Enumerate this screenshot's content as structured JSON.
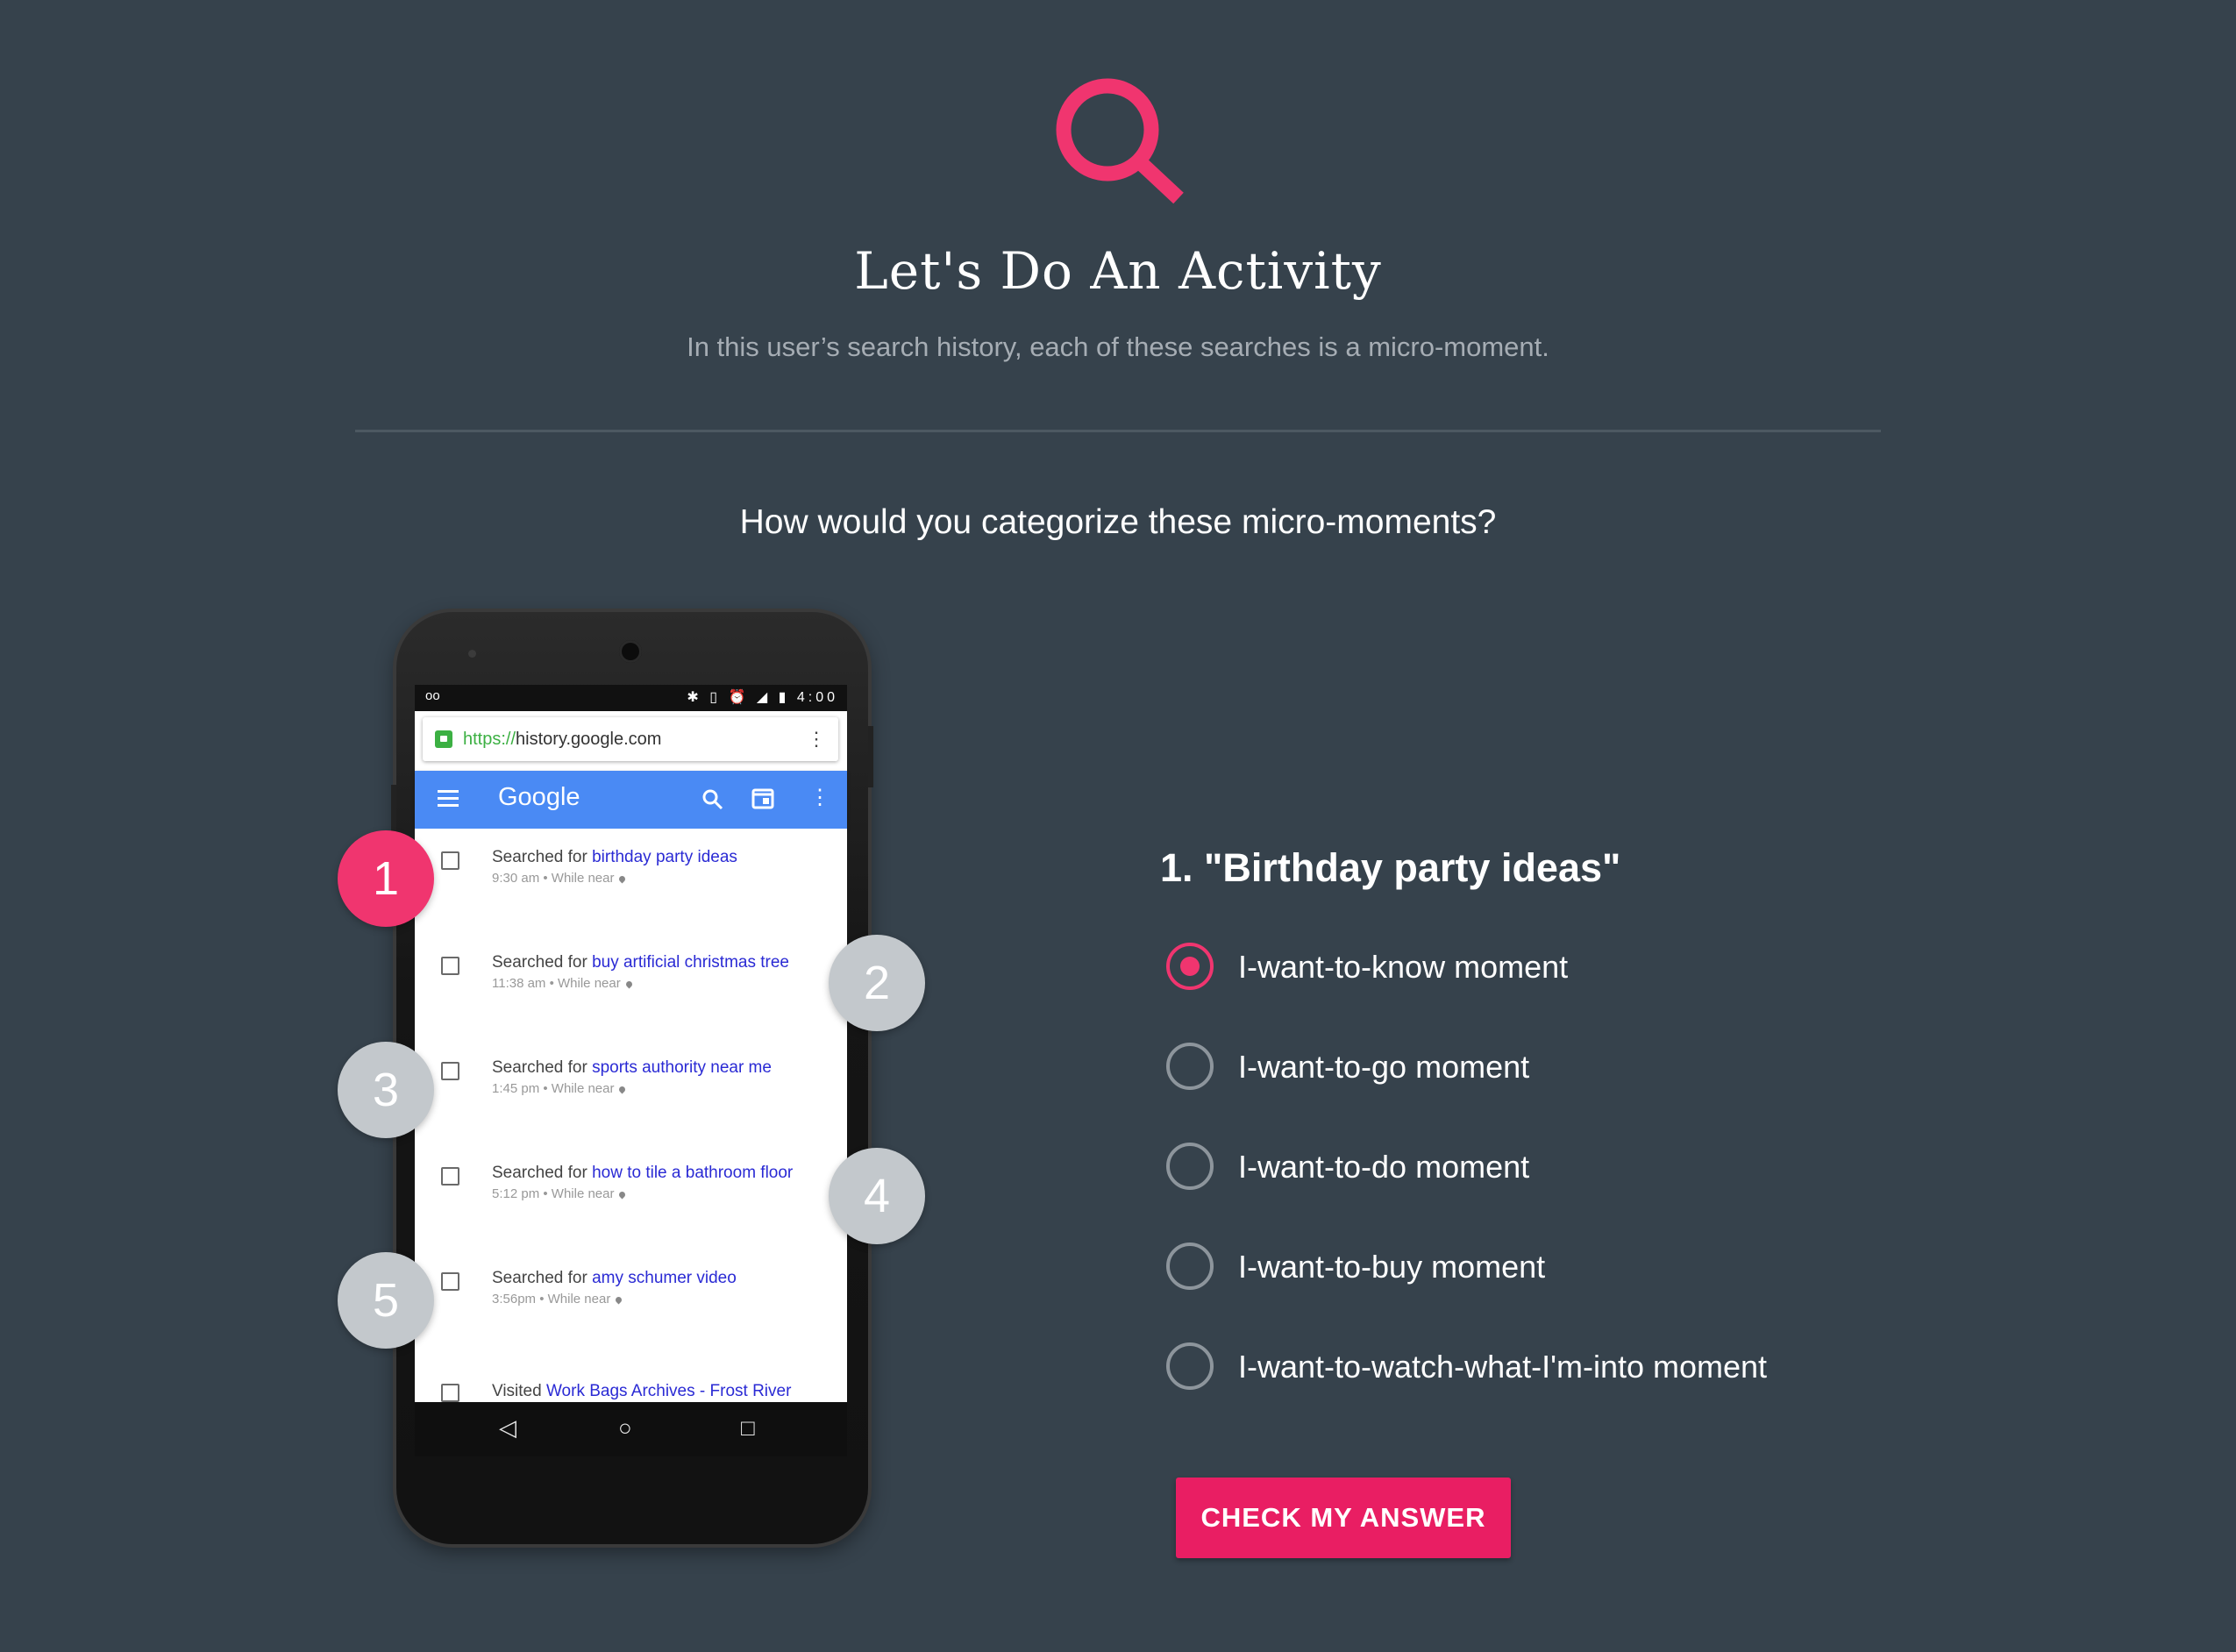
{
  "header": {
    "title": "Let's Do An Activity",
    "subtitle": "In this user’s search history, each of these searches is a micro-moment.",
    "prompt": "How would you categorize these micro-moments?",
    "icon": "search-icon",
    "accent_color": "#f0356f"
  },
  "phone": {
    "status": {
      "left": "oo",
      "icons": "✱ ▯ ⏰ ◢ ▮",
      "time": "4:00"
    },
    "url": {
      "protocol": "https://",
      "host": "history.google.com"
    },
    "app_title": "Google",
    "history": [
      {
        "prefix": "Searched for ",
        "query": "birthday party ideas",
        "meta": "9:30 am • While near"
      },
      {
        "prefix": "Searched for ",
        "query": "buy artificial christmas tree",
        "meta": "11:38 am • While near"
      },
      {
        "prefix": "Searched for ",
        "query": "sports authority near me",
        "meta": "1:45 pm • While near"
      },
      {
        "prefix": "Searched for ",
        "query": "how to tile a bathroom floor",
        "meta": "5:12 pm • While near"
      },
      {
        "prefix": "Searched for ",
        "query": "amy schumer video",
        "meta": "3:56pm • While near"
      },
      {
        "prefix": "Visited ",
        "query": "Work Bags Archives - Frost River",
        "meta": ""
      }
    ],
    "nav": {
      "back": "◁",
      "home": "○",
      "recent": "□"
    }
  },
  "markers": [
    "1",
    "2",
    "3",
    "4",
    "5"
  ],
  "quiz": {
    "question": "1. \"Birthday party ideas\"",
    "selected_index": 0,
    "options": [
      "I-want-to-know moment",
      "I-want-to-go moment",
      "I-want-to-do moment",
      "I-want-to-buy moment",
      "I-want-to-watch-what-I'm-into moment"
    ],
    "button_label": "CHECK MY ANSWER",
    "button_color": "#e91e63"
  }
}
